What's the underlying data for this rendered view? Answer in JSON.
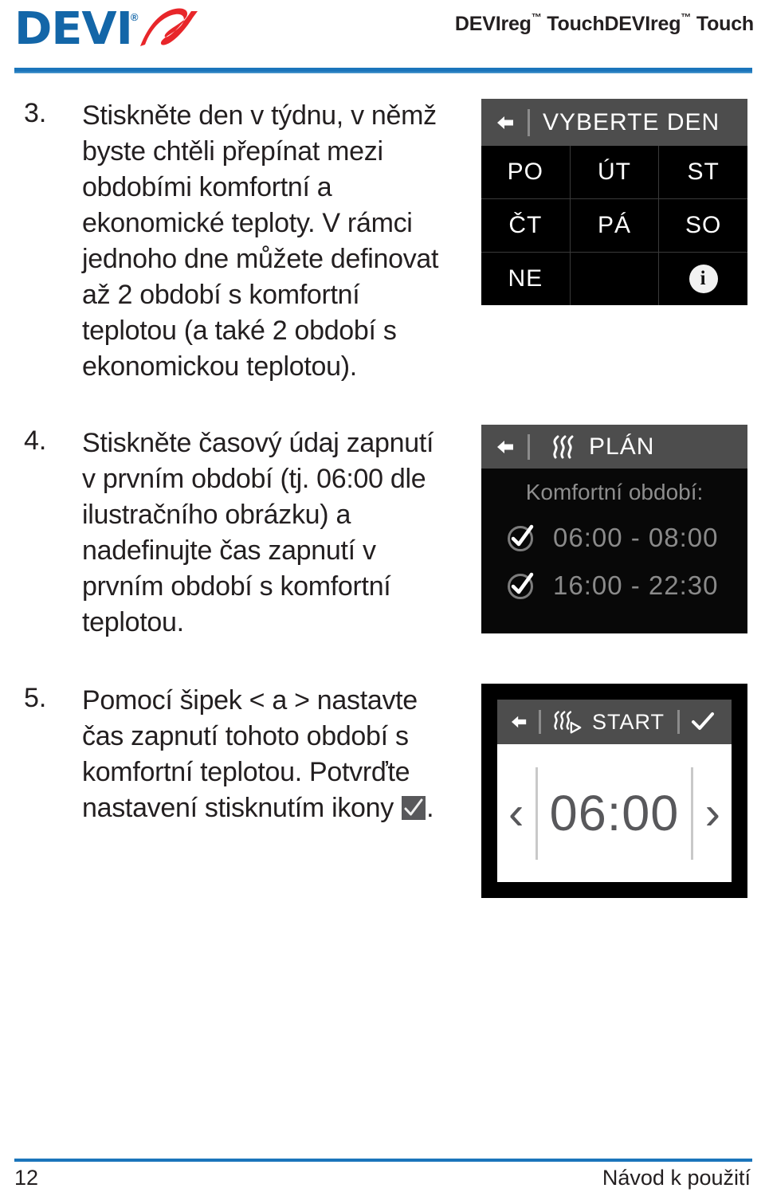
{
  "header": {
    "logo_text": "DEVI",
    "logo_registered": "®",
    "logo_mark": "devi-swoosh-logo",
    "title": "DEVIreg™ TouchDEVIreg™ Touch",
    "title_plain": "DEVIreg Touch DEVIreg Touch",
    "rule_color": "#1b75bb"
  },
  "steps": [
    {
      "number": "3.",
      "text": "Stiskněte den v týdnu, v němž byste chtěli přepínat mezi obdobími komfortní a ekonomické teploty. V rámci jednoho dne můžete definovat až 2 období s komfortní teplotou (a také 2 období s ekonomickou teplotou)."
    },
    {
      "number": "4.",
      "text": "Stiskněte časový údaj zapnutí v prvním období (tj. 06:00 dle ilustračního obrázku) a nadefinujte čas zapnutí v prvním období s komfortní teplotou."
    },
    {
      "number": "5.",
      "text_before": "Pomocí šipek < a > nastavte čas zapnutí tohoto období s komfortní teplotou. Potvrďte nastavení stisknutím ikony ",
      "text_after": "."
    }
  ],
  "screen_select_day": {
    "back_icon": "left-arrow-icon",
    "title": "VYBERTE DEN",
    "days": [
      "PO",
      "ÚT",
      "ST",
      "ČT",
      "PÁ",
      "SO",
      "NE",
      "",
      ""
    ],
    "info_label": "i",
    "info_icon": "info-icon",
    "bg_color": "#000000",
    "topbar_color": "#4d4d4d"
  },
  "screen_plan": {
    "back_icon": "left-arrow-icon",
    "heat_icon": "heat-waves-icon",
    "title": "PLÁN",
    "section_label": "Komfortní období:",
    "periods": [
      {
        "checked": true,
        "range": "06:00 - 08:00"
      },
      {
        "checked": true,
        "range": "16:00 - 22:30"
      }
    ],
    "bg_color": "#080808",
    "topbar_color": "#4d4d4d"
  },
  "screen_start": {
    "back_icon": "left-arrow-icon",
    "heat_icon": "heat-waves-play-icon",
    "title": "START",
    "confirm_icon": "checkmark-icon",
    "prev_icon": "chevron-left-icon",
    "next_icon": "chevron-right-icon",
    "time_value": "06:00",
    "bg_color": "#ffffff",
    "topbar_color": "#4d4d4d"
  },
  "footer": {
    "page_number": "12",
    "document_title": "Návod k použití",
    "rule_color": "#1b75bb"
  }
}
